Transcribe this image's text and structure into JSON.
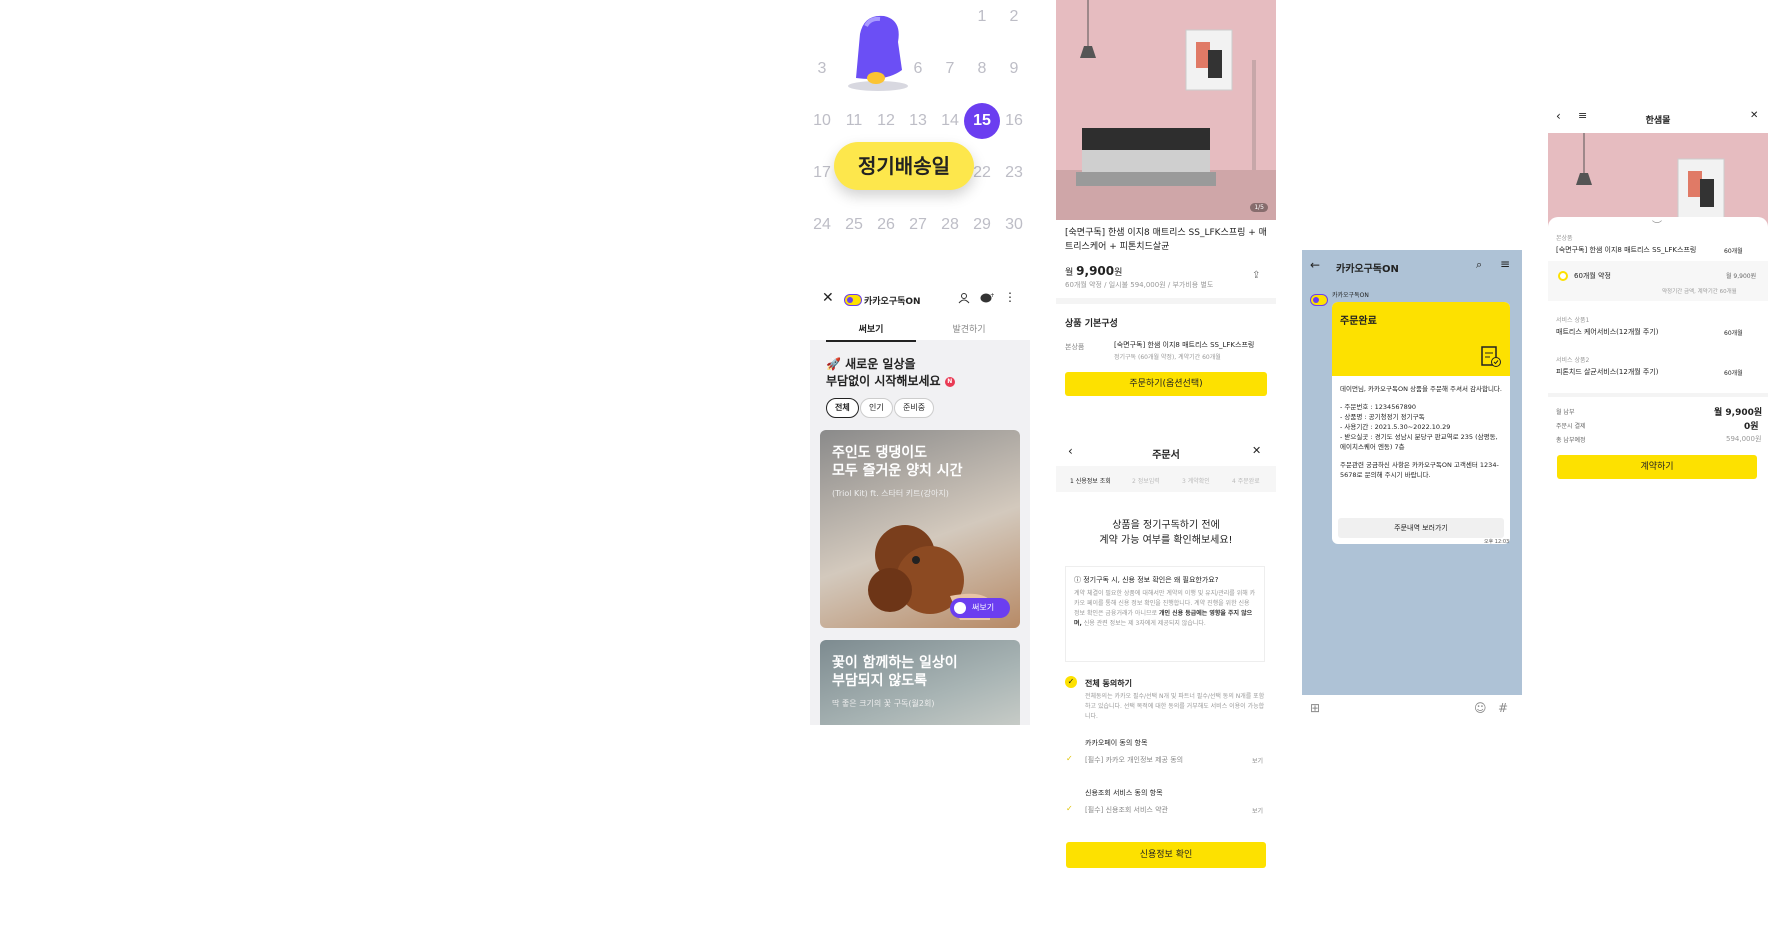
{
  "calendar": {
    "days": [
      "1",
      "2",
      "3",
      "6",
      "7",
      "8",
      "9",
      "10",
      "11",
      "12",
      "13",
      "14",
      "15",
      "16",
      "17",
      "22",
      "23",
      "24",
      "25",
      "26",
      "27",
      "28",
      "29",
      "30"
    ],
    "selected_day": "15",
    "delivery_label": "정기배송일"
  },
  "feed": {
    "service_name": "카카오구독ON",
    "tabs": [
      "써보기",
      "발견하기"
    ],
    "headline_line1": "🚀 새로운 일상을",
    "headline_line2": "부담없이 시작해보세요",
    "headline_badge": "N",
    "chips": [
      "전체",
      "인기",
      "준비중"
    ],
    "card1": {
      "title_line1": "주인도 댕댕이도",
      "title_line2": "모두 즐거운 양치 시간",
      "subtitle": "(Triol Kit) ft. 스타터 키트(강아지)",
      "button": "써보기"
    },
    "card2": {
      "title_line1": "꽃이 함께하는 일상이",
      "title_line2": "부담되지 않도록",
      "subtitle": "딱 좋은 크기의 꽃 구독(월2회)"
    }
  },
  "product": {
    "image_counter": "1/5",
    "name": "[숙면구독] 한샘 이지8 매트리스 SS_LFK스프링 + 매트리스케어 + 피톤치드살균",
    "price_prefix": "월",
    "price": "9,900",
    "price_unit": "원",
    "price_note": "60개월 약정 / 일시불 594,000원 / 부가비용 별도",
    "section_title": "상품 기본구성",
    "item_label": "본상품",
    "item_value": "[숙면구독] 한샘 이지8 매트리스 SS_LFK스프링",
    "item_note": "정기구독 (60개월 약정), 계약기간 60개월",
    "order_button": "주문하기(옵션선택)"
  },
  "order_form": {
    "title": "주문서",
    "steps": [
      "1 신용정보 조회",
      "2 정보입력",
      "3 계약확인",
      "4 주문완료"
    ],
    "headline_line1": "상품을 정기구독하기 전에",
    "headline_line2": "계약 가능 여부를 확인해보세요!",
    "info_title": "정기구독 시, 신용 정보 확인은 왜 필요한가요?",
    "info_body": "계약 체결이 필요한 상품에 대해서만 계약의 이행 및 유지/관리를 위해 카카오 페이를 통해 신용 정보 확인을 진행합니다. 계약 진행을 위한 신용 정보 확인은 금융거래가 아니므로",
    "info_bold": "개인 신용 등급에는 영향을 주지 않으며,",
    "info_tail": "신용 관련 정보는 제 3자에게 제공되지 않습니다.",
    "agree_all": "전체 동의하기",
    "agree_all_desc": "전체동의는 카카오 필수/선택 N개 및 파트너 필수/선택 동의 N개를 포함하고 있습니다. 선택 목적에 대한 동의를 거부해도 서비스 이용이 가능합니다.",
    "group1": "카카오페이 동의 항목",
    "group1_item": "[필수] 카카오 개인정보 제공 동의",
    "group2": "신용조회 서비스 동의 항목",
    "group2_item": "[필수] 신용조회 서비스 약관",
    "view": "보기",
    "confirm_button": "신용정보 확인"
  },
  "chat": {
    "title": "카카오구독ON",
    "sender": "카카오구독ON",
    "card_title": "주문완료",
    "greeting": "데이먼님, 카카오구독ON 상품을 주문해 주셔서 감사합니다.",
    "lines": [
      "- 주문번호 : 1234567890",
      "- 상품명 : 공기청정기 정기구독",
      "- 사용기간 : 2021.5.30~2022.10.29",
      "- 받으실곳 : 경기도 성남시 분당구 판교역로 235 (삼평동, 에이치스퀘어 엔동) 7층"
    ],
    "footer": "주문관련 궁금하신 사항은 카카오구독ON 고객센터 1234-5678로 문의해 주시기 바랍니다.",
    "button": "주문내역 보러가기",
    "time": "오후 12:03"
  },
  "options": {
    "title": "한샘몰",
    "main_label": "본상품",
    "main_value": "[숙면구독] 한샘 이지8 매트리스 SS_LFK스프링",
    "main_period": "60개월",
    "plan_label": "60개월 약정",
    "plan_price": "월 9,900원",
    "plan_note": "약정기간 금액, 계약기간 60개월",
    "svc1_label": "서비스 상품1",
    "svc1_value": "매트리스 케어서비스(12개월 주기)",
    "svc1_period": "60개월",
    "svc2_label": "서비스 상품2",
    "svc2_value": "피톤치드 살균서비스(12개월 주기)",
    "svc2_period": "60개월",
    "monthly_label": "월 납부",
    "monthly_value": "월 9,900원",
    "order_pay_label": "주문시 결제",
    "order_pay_value": "0원",
    "total_label": "총 납부예정",
    "total_value": "594,000원",
    "button": "계약하기"
  },
  "colors": {
    "yellow": "#fde100",
    "purple": "#6b3ef0",
    "chat_bg": "#aec2d6"
  }
}
